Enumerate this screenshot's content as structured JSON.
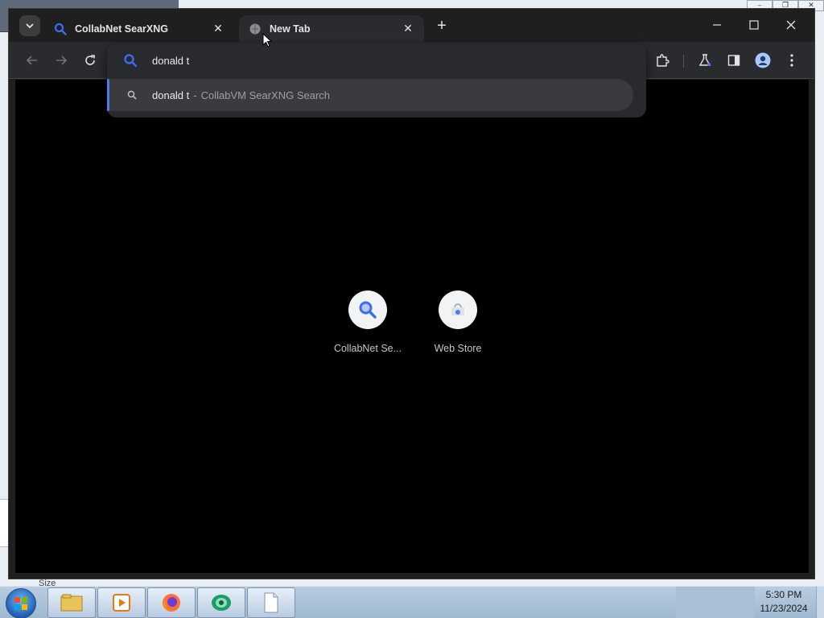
{
  "browser": {
    "tabs": [
      {
        "title": "CollabNet SearXNG",
        "favicon": "search-icon",
        "active": false
      },
      {
        "title": "New Tab",
        "favicon": "globe-icon",
        "active": true
      }
    ],
    "window_controls": [
      "minimize",
      "maximize",
      "close"
    ]
  },
  "toolbar": {
    "nav": [
      "back-arrow-icon",
      "forward-arrow-icon",
      "reload-icon"
    ],
    "right_icons": [
      "extensions-icon",
      "labs-flask-icon",
      "side-panel-icon",
      "profile-icon",
      "menu-dots-icon"
    ]
  },
  "omnibox": {
    "value": "donald t",
    "suggestion": {
      "query": "donald t",
      "separator": "-",
      "provider": "CollabVM SearXNG Search"
    }
  },
  "shortcuts": [
    {
      "label": "CollabNet Se...",
      "icon": "search-icon"
    },
    {
      "label": "Web Store",
      "icon": "web-store-icon"
    }
  ],
  "background": {
    "size_label": "Size"
  },
  "taskbar": {
    "time": "5:30 PM",
    "date": "11/23/2024",
    "apps": [
      "file-explorer-icon",
      "media-player-icon",
      "firefox-icon",
      "browser-icon",
      "notepad-icon"
    ]
  },
  "colors": {
    "accent": "#4a7cf0",
    "tab_active": "#2a2b2e",
    "frame": "#1f1f1f"
  }
}
